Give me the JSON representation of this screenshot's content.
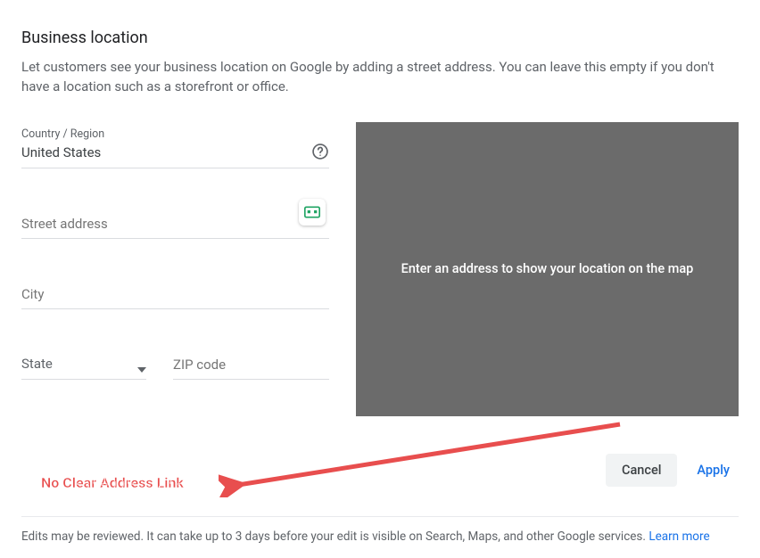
{
  "dialog": {
    "title": "Business location",
    "description": "Let customers see your business location on Google by adding a street address. You can leave this empty if you don't have a location such as a storefront or office."
  },
  "form": {
    "country": {
      "label": "Country / Region",
      "value": "United States"
    },
    "street": {
      "label": "Street address",
      "value": ""
    },
    "city": {
      "label": "City",
      "value": ""
    },
    "state": {
      "label": "State",
      "value": ""
    },
    "zip": {
      "label": "ZIP code",
      "value": ""
    }
  },
  "map": {
    "placeholder": "Enter an address to show your location on the map"
  },
  "actions": {
    "cancel": "Cancel",
    "apply": "Apply"
  },
  "footer": {
    "text": "Edits may be reviewed. It can take up to 3 days before your edit is visible on Search, Maps, and other Google services. ",
    "link": "Learn more"
  },
  "annotation": {
    "text": "No Clear Address Link"
  }
}
